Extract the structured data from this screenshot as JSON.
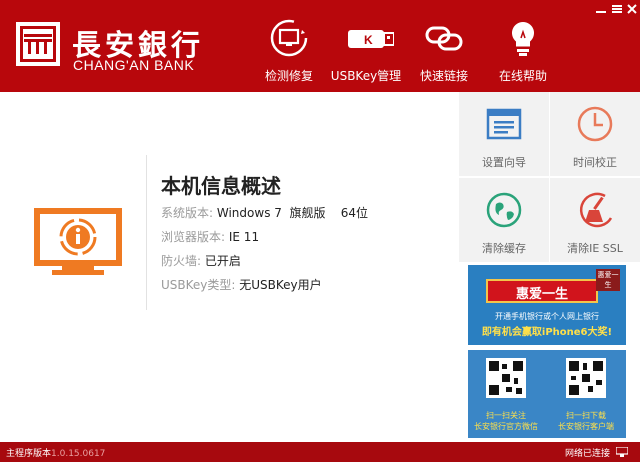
{
  "brand": {
    "name_cn": "長安銀行",
    "name_en": "CHANG'AN BANK",
    "color": "#b8070c"
  },
  "window_controls": {
    "minimize_icon": "minimize-icon",
    "close_icon": "close-icon"
  },
  "nav": [
    {
      "label": "检测修复",
      "icon": "monitor-refresh-icon"
    },
    {
      "label": "USBKey管理",
      "icon": "usb-key-icon"
    },
    {
      "label": "快速链接",
      "icon": "link-icon"
    },
    {
      "label": "在线帮助",
      "icon": "lightbulb-icon"
    }
  ],
  "info": {
    "title": "本机信息概述",
    "rows": [
      {
        "key": "系统版本:",
        "value": "Windows 7  旗舰版    64位"
      },
      {
        "key": "浏览器版本:",
        "value": "IE 11"
      },
      {
        "key": "防火墙:",
        "value": "已开启"
      },
      {
        "key": "USBKey类型:",
        "value": "无USBKey用户"
      }
    ],
    "icon": "info-monitor-icon",
    "accent": "#ef7a22"
  },
  "tiles": [
    {
      "label": "设置向导",
      "icon": "setup-wizard-icon",
      "color": "#3b7dc4"
    },
    {
      "label": "时间校正",
      "icon": "clock-icon",
      "color": "#e87a5a"
    },
    {
      "label": "清除缓存",
      "icon": "globe-clean-icon",
      "color": "#2aa37a"
    },
    {
      "label": "清除IE SSL",
      "icon": "broom-icon",
      "color": "#d9453a"
    }
  ],
  "promo1": {
    "ribbon": "惠爱一生",
    "badge": "惠爱一生",
    "line1": "开通手机银行或个人网上银行",
    "line2": "即有机会赢取iPhone6大奖!"
  },
  "promo2": {
    "caption_left_1": "扫一扫关注",
    "caption_left_2": "长安银行官方微信",
    "caption_right_1": "扫一扫下载",
    "caption_right_2": "长安银行客户端"
  },
  "footer": {
    "version_label": "主程序版本",
    "version": "1.0.15.0617",
    "network_status": "网络已连接"
  }
}
